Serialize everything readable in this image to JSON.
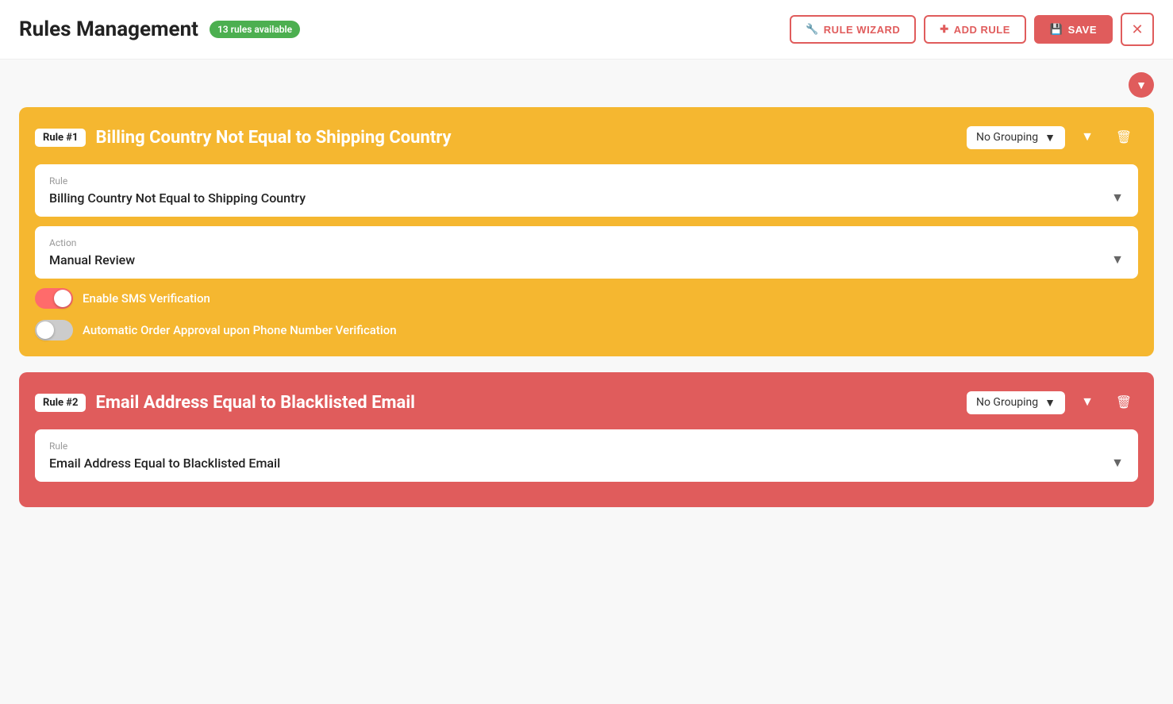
{
  "header": {
    "title": "Rules Management",
    "badge": "13 rules available",
    "buttons": {
      "wizard": "RULE WIZARD",
      "add": "ADD RULE",
      "save": "SAVE",
      "close_icon": "✕"
    }
  },
  "colors": {
    "accent": "#e05c5c",
    "yellow": "#f5b730",
    "green": "#4caf50"
  },
  "rules": [
    {
      "id": "rule-1",
      "label": "Rule #1",
      "title": "Billing Country Not Equal to Shipping Country",
      "grouping": "No Grouping",
      "rule_field_label": "Rule",
      "rule_field_value": "Billing Country Not Equal to Shipping Country",
      "action_field_label": "Action",
      "action_field_value": "Manual Review",
      "toggle_sms_label": "Enable SMS Verification",
      "toggle_sms_on": true,
      "toggle_approval_label": "Automatic Order Approval upon Phone Number Verification",
      "toggle_approval_on": false,
      "color": "yellow"
    },
    {
      "id": "rule-2",
      "label": "Rule #2",
      "title": "Email Address Equal to Blacklisted Email",
      "grouping": "No Grouping",
      "rule_field_label": "Rule",
      "rule_field_value": "Email Address Equal to Blacklisted Email",
      "color": "red"
    }
  ]
}
